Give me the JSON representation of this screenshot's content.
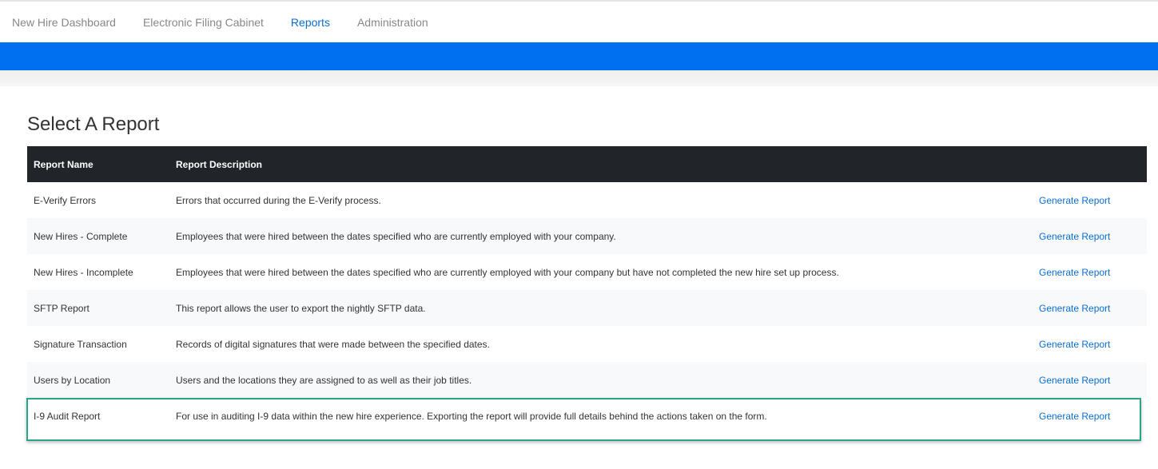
{
  "nav": {
    "items": [
      {
        "label": "New Hire Dashboard",
        "active": false
      },
      {
        "label": "Electronic Filing Cabinet",
        "active": false
      },
      {
        "label": "Reports",
        "active": true
      },
      {
        "label": "Administration",
        "active": false
      }
    ]
  },
  "page": {
    "title": "Select A Report"
  },
  "table": {
    "headers": {
      "name": "Report Name",
      "description": "Report Description"
    },
    "rows": [
      {
        "name": "E-Verify Errors",
        "description": "Errors that occurred during the E-Verify process.",
        "action": "Generate Report"
      },
      {
        "name": "New Hires - Complete",
        "description": "Employees that were hired between the dates specified who are currently employed with your company.",
        "action": "Generate Report"
      },
      {
        "name": "New Hires - Incomplete",
        "description": "Employees that were hired between the dates specified who are currently employed with your company but have not completed the new hire set up process.",
        "action": "Generate Report"
      },
      {
        "name": "SFTP Report",
        "description": "This report allows the user to export the nightly SFTP data.",
        "action": "Generate Report"
      },
      {
        "name": "Signature Transaction",
        "description": "Records of digital signatures that were made between the specified dates.",
        "action": "Generate Report"
      },
      {
        "name": "Users by Location",
        "description": "Users and the locations they are assigned to as well as their job titles.",
        "action": "Generate Report"
      },
      {
        "name": "I-9 Audit Report",
        "description": "For use in auditing I-9 data within the new hire experience. Exporting the report will provide full details behind the actions taken on the form.",
        "action": "Generate Report"
      }
    ]
  },
  "colors": {
    "brand_blue": "#0070f0",
    "link": "#0a6ed1",
    "header_bg": "#212529",
    "highlight": "#2aa58a"
  }
}
